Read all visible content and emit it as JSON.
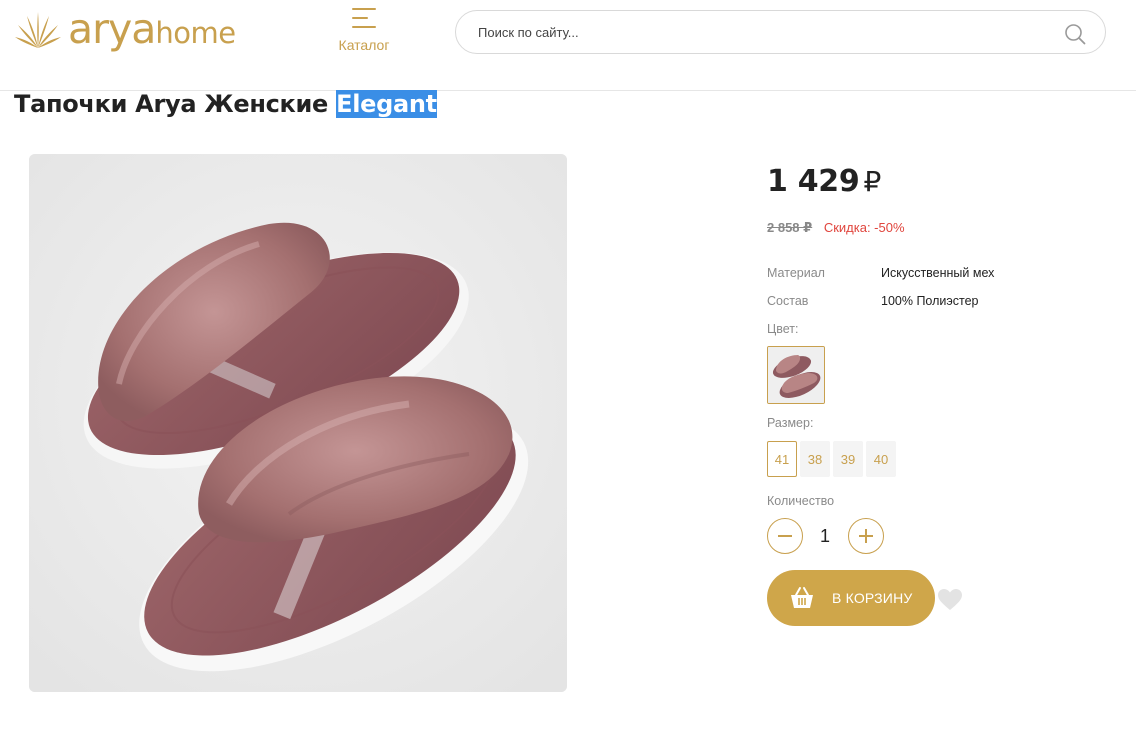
{
  "header": {
    "logo_text_main": "arya",
    "logo_text_sub": "home",
    "catalog_label": "Каталог",
    "search_placeholder": "Поиск по сайту..."
  },
  "product": {
    "title_main": "Тапочки Arya Женские ",
    "title_highlight": "Elegant",
    "image_alt": "pink faux fur slippers",
    "price": "1 429",
    "currency": "₽",
    "old_price": "2 858 ₽",
    "discount": "Скидка: -50%",
    "properties": [
      {
        "key": "Материал",
        "value": "Искусственный мех"
      },
      {
        "key": "Состав",
        "value": "100% Полиэстер"
      }
    ],
    "color_label": "Цвет:",
    "size_label": "Размер:",
    "sizes": [
      "41",
      "38",
      "39",
      "40"
    ],
    "selected_size": "41",
    "quantity_label": "Количество",
    "quantity": "1",
    "add_to_cart_label": "В КОРЗИНУ"
  },
  "colors": {
    "accent": "#c8a04e",
    "button": "#cfa64a",
    "discount": "#e0453d",
    "highlight": "#3a8ee6"
  }
}
